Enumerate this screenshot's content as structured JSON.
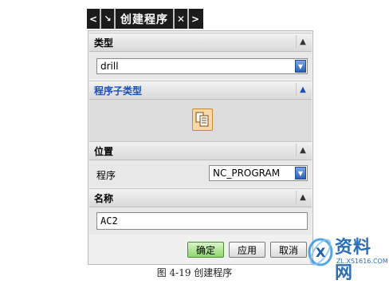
{
  "window": {
    "title": "创建程序",
    "nav_back_glyph": "<",
    "tool_glyph": "↘",
    "close_glyph": "✕",
    "nav_forward_glyph": ">"
  },
  "sections": {
    "type": {
      "label": "类型",
      "value": "drill"
    },
    "subtype": {
      "label": "程序子类型",
      "icon": "program-subtype-icon"
    },
    "location": {
      "label": "位置",
      "field_label": "程序",
      "value": "NC_PROGRAM"
    },
    "name": {
      "label": "名称",
      "value": "AC2"
    }
  },
  "buttons": {
    "ok": "确定",
    "apply": "应用",
    "cancel": "取消"
  },
  "caption": "图 4-19  创建程序",
  "watermark": {
    "text": "资料网",
    "sub": "ZL.XS1616.COM"
  },
  "colors": {
    "accent_blue": "#1a4fb5",
    "ok_green": "#8fd66e",
    "icon_orange": "#f7d8a6"
  }
}
